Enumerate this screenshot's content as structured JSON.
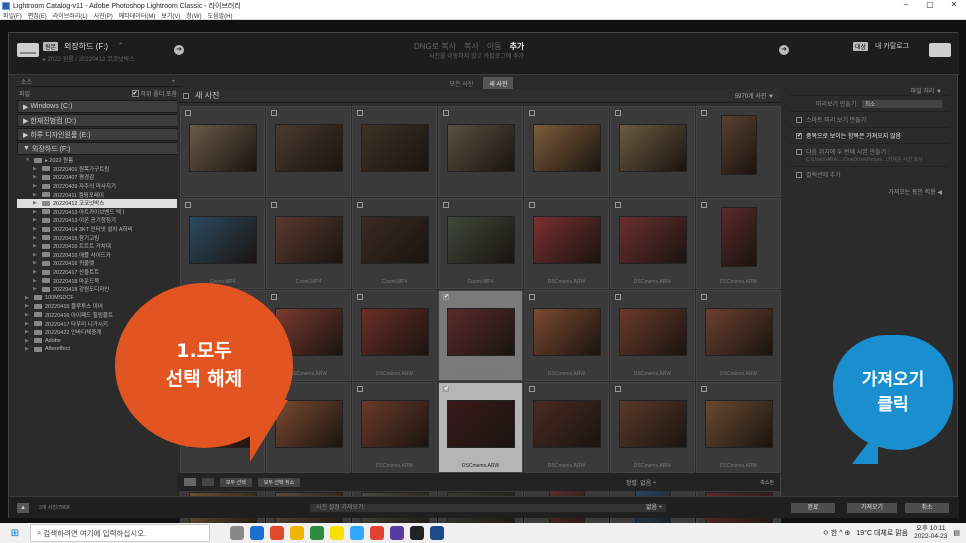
{
  "window": {
    "title": "Lightroom Catalog-v11 - Adobe Photoshop Lightroom Classic - 라이브러리",
    "controls": [
      "–",
      "▢",
      "✕"
    ]
  },
  "menu": [
    "파일(F)",
    "편집(E)",
    "라이브러리(L)",
    "사진(P)",
    "메타데이터(M)",
    "보기(V)",
    "창(W)",
    "도움말(H)"
  ],
  "importbar": {
    "source_prefix": "원본",
    "source_name": "외장하드 (F:)",
    "source_dropdown": "÷",
    "source_path": "▸ 2022 원룸 / 20220412 코코넛박스",
    "modes": [
      "DNG로 복사",
      "복사",
      "이동",
      "추가"
    ],
    "active_mode_index": 3,
    "mode_sub": "사진을 이동하지 않고 카탈로그에 추가",
    "dest_prefix": "대상",
    "dest_name": "내 카탈로그"
  },
  "filter_tabs": [
    "모든 사진",
    "새 사진"
  ],
  "active_filter_index": 1,
  "left": {
    "header": "소스",
    "header_plus": "+",
    "files_label": "파일",
    "subfolder_label": "하위 폴더 포함",
    "volumes": [
      "Windows (C:)",
      "한재진범컴 (D:)",
      "하루 디자인원룸 (E:)",
      "외장하드 (F:)"
    ],
    "tree": [
      {
        "label": "▸ 2022 원룸",
        "indent": 1,
        "open": true
      },
      {
        "label": "20220401 원목가구트림",
        "indent": 2
      },
      {
        "label": "20220407 평경감",
        "indent": 2
      },
      {
        "label": "20220409 자주의 마사지기",
        "indent": 2
      },
      {
        "label": "20220411 캠핑포레이",
        "indent": 2
      },
      {
        "label": "20220412 코코넛박스",
        "indent": 2,
        "selected": true
      },
      {
        "label": "20220413 아트카이브밴드 텍ㅣ",
        "indent": 2
      },
      {
        "label": "20220413 이온 공기청정기",
        "indent": 2
      },
      {
        "label": "20220414 3KT 인터넷 설치 A하비",
        "indent": 2
      },
      {
        "label": "20220415 참기고림",
        "indent": 2
      },
      {
        "label": "20220416 트트트 거치대",
        "indent": 2
      },
      {
        "label": "20220416 애플 사이드카",
        "indent": 2
      },
      {
        "label": "20220416 퀴블렛",
        "indent": 2
      },
      {
        "label": "20220417 산울트트",
        "indent": 2
      },
      {
        "label": "20220418 마운드묵",
        "indent": 2
      },
      {
        "label": "20220418 강원도디자인",
        "indent": 2
      },
      {
        "label": "100MSDCF",
        "indent": 1
      },
      {
        "label": "20220415 블루투스 이어",
        "indent": 1
      },
      {
        "label": "20220416 아이패드 힐링블트",
        "indent": 1
      },
      {
        "label": "20220417 타우미 니가시키",
        "indent": 1
      },
      {
        "label": "20220422 인바디체중계",
        "indent": 1
      },
      {
        "label": "Adobe",
        "indent": 1
      },
      {
        "label": "Aftereffect",
        "indent": 1
      }
    ]
  },
  "grid": {
    "title": "새 사진",
    "sort_label": "5970개 사진",
    "cells": [
      {
        "fn": "",
        "checked": false,
        "color": "#6b5a48",
        "tall": false
      },
      {
        "fn": "",
        "checked": false,
        "color": "#4a3a2e",
        "tall": false
      },
      {
        "fn": "",
        "checked": false,
        "color": "#3e3226",
        "tall": false
      },
      {
        "fn": "",
        "checked": false,
        "color": "#5a5040",
        "tall": false
      },
      {
        "fn": "",
        "checked": false,
        "color": "#7d5c3a",
        "tall": false
      },
      {
        "fn": "",
        "checked": false,
        "color": "#6b5a40",
        "tall": false
      },
      {
        "fn": "",
        "checked": false,
        "color": "#5a4030",
        "tall": true
      },
      {
        "fn": "Cosmi.MP4",
        "checked": false,
        "color": "#2a4a60",
        "tall": false
      },
      {
        "fn": "Cosmi.MP4",
        "checked": false,
        "color": "#5a3a30",
        "tall": false
      },
      {
        "fn": "Cosmi.MP4",
        "checked": false,
        "color": "#3a2a22",
        "tall": false
      },
      {
        "fn": "Cosmi.MP4",
        "checked": false,
        "color": "#3e4a3a",
        "tall": false
      },
      {
        "fn": "DSCmems.ARW",
        "checked": false,
        "color": "#7a3030",
        "tall": false
      },
      {
        "fn": "DSCmems.ARW",
        "checked": false,
        "color": "#6a3030",
        "tall": false
      },
      {
        "fn": "DSCmems.ARW",
        "checked": false,
        "color": "#5a2a2a",
        "tall": true
      },
      {
        "fn": "",
        "checked": false,
        "color": "#6a2a2a",
        "tall": true
      },
      {
        "fn": "DSCmems.ARW",
        "checked": false,
        "color": "#7a3a30",
        "tall": false
      },
      {
        "fn": "DSCmems.ARW",
        "checked": false,
        "color": "#6a2e28",
        "tall": false
      },
      {
        "fn": "DSCmems.ARW",
        "checked": true,
        "color": "#5a2a2a",
        "tall": false,
        "sel": "w"
      },
      {
        "fn": "DSCmems.ARW",
        "checked": false,
        "color": "#7a4a30",
        "tall": false
      },
      {
        "fn": "DSCmems.ARW",
        "checked": false,
        "color": "#6a3a2a",
        "tall": false
      },
      {
        "fn": "DSCmems.ARW",
        "checked": false,
        "color": "#6a4030",
        "tall": false
      },
      {
        "fn": "",
        "checked": false,
        "color": "#7a2a2a",
        "tall": false
      },
      {
        "fn": "",
        "checked": false,
        "color": "#7a4a30",
        "tall": false
      },
      {
        "fn": "DSCmems.ARW",
        "checked": false,
        "color": "#6a3a2a",
        "tall": false
      },
      {
        "fn": "DSCmems.ARW",
        "checked": true,
        "color": "#3a1a1a",
        "tall": false,
        "sel": "g"
      },
      {
        "fn": "DSCmems.ARW",
        "checked": false,
        "color": "#4a2a22",
        "tall": false
      },
      {
        "fn": "DSCmems.ARW",
        "checked": false,
        "color": "#5a3a2a",
        "tall": false
      },
      {
        "fn": "DSCmems.ARW",
        "checked": false,
        "color": "#6a4a30",
        "tall": false
      },
      {
        "fn": "",
        "checked": false,
        "color": "#6a5030",
        "tall": false
      },
      {
        "fn": "",
        "checked": false,
        "color": "#5a4a3a",
        "tall": false
      },
      {
        "fn": "",
        "checked": false,
        "color": "#4a4a40",
        "tall": false
      },
      {
        "fn": "",
        "checked": false,
        "color": "#3a3a36",
        "tall": false
      },
      {
        "fn": "",
        "checked": false,
        "color": "#5a3030",
        "tall": true
      },
      {
        "fn": "",
        "checked": false,
        "color": "#2a4a6a",
        "tall": true
      },
      {
        "fn": "",
        "checked": false,
        "color": "#5a2a2a",
        "tall": false
      }
    ]
  },
  "grid_toolbar": {
    "select_all": "모두 선택",
    "deselect_all": "모두 선택 취소",
    "sort": "정렬: 없음 ÷",
    "thumb": "축소판"
  },
  "right": {
    "header": "파일 처리 ▼",
    "preview_label": "미리보기 만들기:",
    "preview_value": "최소",
    "rows": [
      {
        "label": "스마트 미리 보기 만들기",
        "checked": false
      },
      {
        "label": "중복으로 보이는 항목은 가져오지 않음",
        "checked": true
      },
      {
        "label": "다음 위치에 두 번째 사본 만들기 :",
        "checked": false
      },
      {
        "label": "컬렉션에 추가",
        "checked": false
      }
    ],
    "sub_path": "C:\\Users\\ARA\\...\\OneDrive\\Picture...\\가져온 사진 복사",
    "apply_label": "가져오는 동안 적용 ◀"
  },
  "bottom": {
    "count": "3개 사진/7968",
    "preset_label": "사진 설정 가져오기:",
    "preset_value": "없음 ÷",
    "import": "가져오기",
    "cancel": "취소",
    "done": "완료"
  },
  "callouts": {
    "left_line1": "1.모두",
    "left_line2": "선택 해제",
    "right_line1": "가져오기",
    "right_line2": "클릭"
  },
  "taskbar": {
    "search": "검색하려면 여기에 입력하십시오.",
    "weather": "19°C 대체로 맑음",
    "time": "오후 10:11",
    "date": "2022-04-23",
    "lang": "ㅇ 한 ^ ⊕"
  }
}
